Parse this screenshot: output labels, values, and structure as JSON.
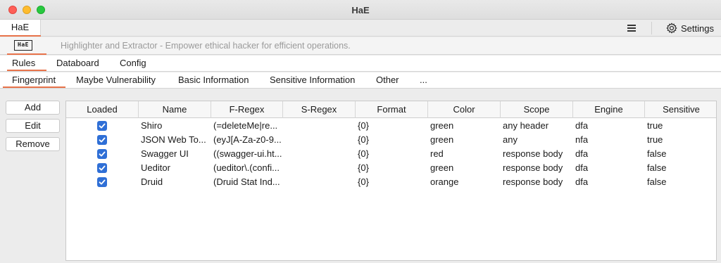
{
  "window": {
    "title": "HaE"
  },
  "top_tabs": {
    "active": "HaE",
    "settings_label": "Settings"
  },
  "banner": {
    "logo_text": "HaE",
    "tagline": "Highlighter and Extractor - Empower ethical hacker for efficient operations."
  },
  "main_tabs": [
    {
      "label": "Rules",
      "active": true
    },
    {
      "label": "Databoard",
      "active": false
    },
    {
      "label": "Config",
      "active": false
    }
  ],
  "rule_tabs": [
    {
      "label": "Fingerprint",
      "active": true
    },
    {
      "label": "Maybe Vulnerability",
      "active": false
    },
    {
      "label": "Basic Information",
      "active": false
    },
    {
      "label": "Sensitive Information",
      "active": false
    },
    {
      "label": "Other",
      "active": false
    },
    {
      "label": "...",
      "active": false
    }
  ],
  "actions": {
    "add": "Add",
    "edit": "Edit",
    "remove": "Remove"
  },
  "table": {
    "columns": [
      "Loaded",
      "Name",
      "F-Regex",
      "S-Regex",
      "Format",
      "Color",
      "Scope",
      "Engine",
      "Sensitive"
    ],
    "rows": [
      {
        "loaded": true,
        "name": "Shiro",
        "f_regex": "(=deleteMe|re...",
        "s_regex": "",
        "format": "{0}",
        "color": "green",
        "scope": "any header",
        "engine": "dfa",
        "sensitive": "true"
      },
      {
        "loaded": true,
        "name": "JSON Web To...",
        "f_regex": "(eyJ[A-Za-z0-9...",
        "s_regex": "",
        "format": "{0}",
        "color": "green",
        "scope": "any",
        "engine": "nfa",
        "sensitive": "true"
      },
      {
        "loaded": true,
        "name": "Swagger UI",
        "f_regex": "((swagger-ui.ht...",
        "s_regex": "",
        "format": "{0}",
        "color": "red",
        "scope": "response body",
        "engine": "dfa",
        "sensitive": "false"
      },
      {
        "loaded": true,
        "name": "Ueditor",
        "f_regex": "(ueditor\\.(confi...",
        "s_regex": "",
        "format": "{0}",
        "color": "green",
        "scope": "response body",
        "engine": "dfa",
        "sensitive": "false"
      },
      {
        "loaded": true,
        "name": "Druid",
        "f_regex": "(Druid Stat Ind...",
        "s_regex": "",
        "format": "{0}",
        "color": "orange",
        "scope": "response body",
        "engine": "dfa",
        "sensitive": "false"
      }
    ]
  },
  "colors": {
    "accent": "#e8734a",
    "checkbox": "#2f6fd6"
  }
}
